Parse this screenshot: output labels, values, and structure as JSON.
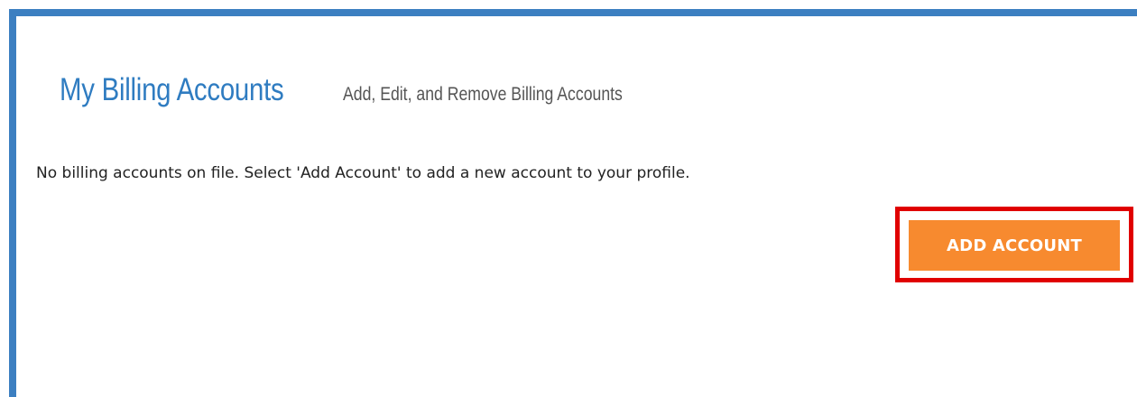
{
  "header": {
    "title": "My Billing Accounts",
    "subtitle": "Add, Edit, and Remove Billing Accounts"
  },
  "content": {
    "empty_message": "No billing accounts on file. Select 'Add Account' to add a new account to your profile."
  },
  "actions": {
    "add_account_label": "ADD ACCOUNT"
  },
  "colors": {
    "frame_border": "#3c7fc1",
    "title": "#2f7cc1",
    "button": "#f78a2f",
    "highlight": "#e00000"
  }
}
